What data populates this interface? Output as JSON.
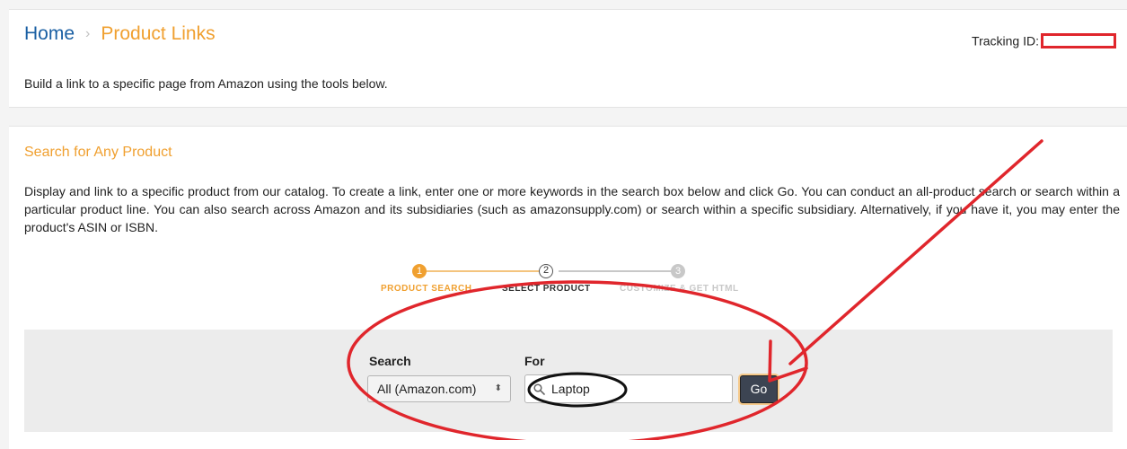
{
  "header": {
    "breadcrumb_home": "Home",
    "breadcrumb_separator": "›",
    "breadcrumb_current": "Product Links",
    "tracking_label": "Tracking ID:",
    "subtitle": "Build a link to a specific page from Amazon using the tools below."
  },
  "section": {
    "title": "Search for Any Product",
    "description": "Display and link to a specific product from our catalog. To create a link, enter one or more keywords in the search box below and click Go. You can conduct an all-product search or search within a particular product line. You can also search across Amazon and its subsidiaries (such as amazonsupply.com) or search within a specific subsidiary. Alternatively, if you have it, you may enter the product's ASIN or ISBN."
  },
  "steps": [
    {
      "number": "1",
      "label": "PRODUCT SEARCH",
      "state": "completed"
    },
    {
      "number": "2",
      "label": "SELECT PRODUCT",
      "state": "current"
    },
    {
      "number": "3",
      "label": "CUSTOMIZE & GET HTML",
      "state": "upcoming"
    }
  ],
  "search_form": {
    "search_label": "Search",
    "for_label": "For",
    "selected_category": "All (Amazon.com)",
    "select_arrow": "⬍",
    "query_value": "Laptop",
    "go_label": "Go"
  },
  "icons": {
    "search": "search-icon",
    "select_arrow": "updown-arrow-icon"
  },
  "colors": {
    "brand_orange": "#f0a030",
    "link_blue": "#1a5fa3",
    "annotation_red": "#e0262c",
    "go_button": "#3c4452"
  }
}
